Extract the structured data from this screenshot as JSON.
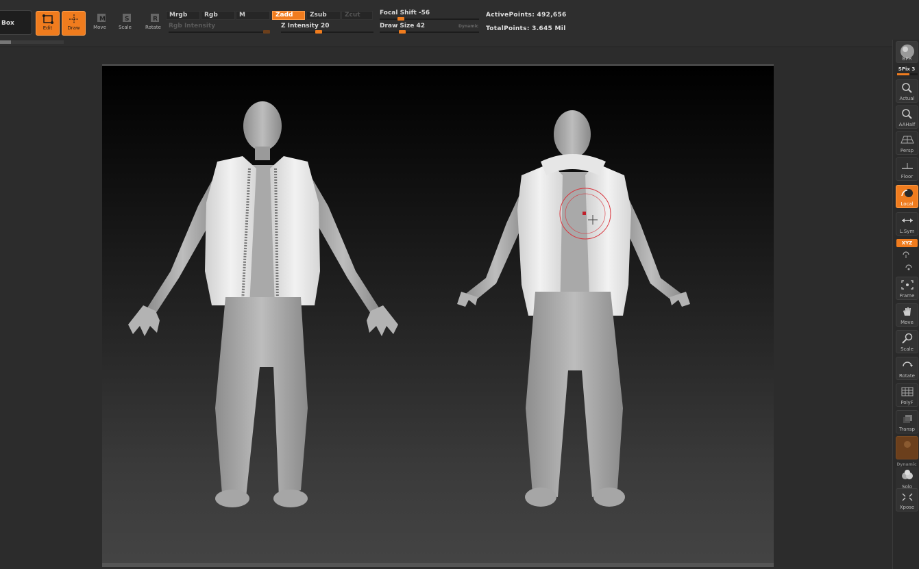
{
  "toolbar": {
    "zbox_label": "Box",
    "modes": [
      {
        "label": "Edit",
        "active": true
      },
      {
        "label": "Draw",
        "active": true
      },
      {
        "label": "Move",
        "active": false
      },
      {
        "label": "Scale",
        "active": false
      },
      {
        "label": "Rotate",
        "active": false
      }
    ],
    "color_chips": {
      "mrgb": "Mrgb",
      "rgb": "Rgb",
      "m": "M"
    },
    "rgb_intensity_label": "Rgb Intensity",
    "sculpt_chips": {
      "zadd": "Zadd",
      "zsub": "Zsub",
      "zcut": "Zcut"
    },
    "z_intensity": {
      "label": "Z Intensity 20",
      "value": 20
    },
    "focal_shift": {
      "label": "Focal Shift -56",
      "value": -56
    },
    "draw_size": {
      "label": "Draw Size 42",
      "value": 42
    },
    "dynamic_label": "Dynamic"
  },
  "stats": {
    "active_points": "ActivePoints: 492,656",
    "total_points": "TotalPoints: 3.645 Mil"
  },
  "right_shelf": {
    "bpr": "BPR",
    "spix": "SPix 3",
    "actual": "Actual",
    "aahalf": "AAHalf",
    "persp": "Persp",
    "floor": "Floor",
    "local": "Local",
    "lsym": "L.Sym",
    "xyz": "XYZ",
    "frame": "Frame",
    "move": "Move",
    "scale": "Scale",
    "rotate": "Rotate",
    "polyf": "PolyF",
    "transp": "Transp",
    "dynamic": "Dynamic",
    "solo": "Solo",
    "xpose": "Xpose"
  },
  "colors": {
    "accent": "#f07c1e",
    "panel": "#2e2e2e",
    "brush_ring": "#d9363e"
  }
}
